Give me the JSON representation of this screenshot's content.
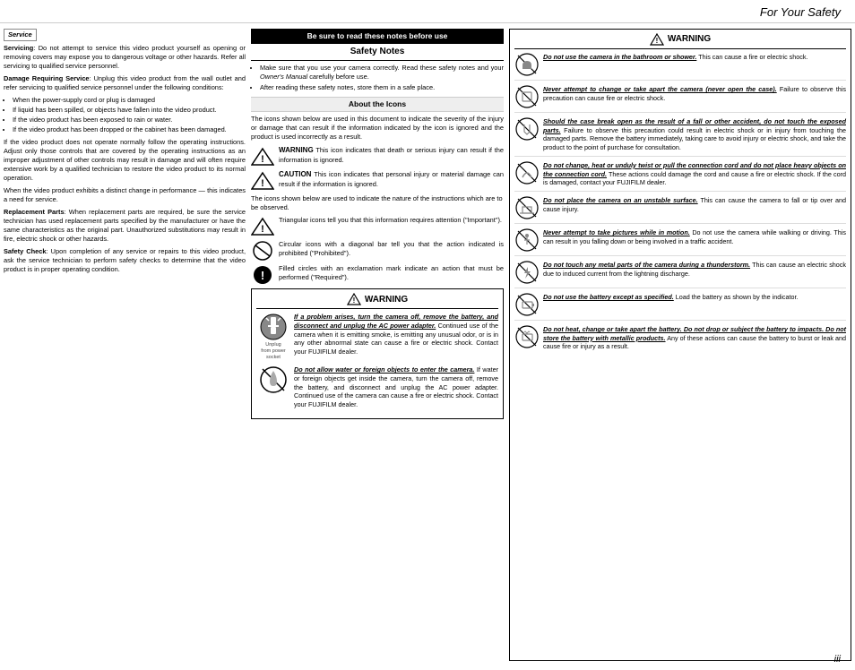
{
  "header": {
    "title": "For Your Safety"
  },
  "footer": {
    "page": "iii"
  },
  "left_column": {
    "service_label": "Service",
    "paragraphs": [
      {
        "label": "Servicing",
        "text": ": Do not attempt to service this video product yourself as opening or removing covers may expose you to dangerous voltage or other hazards.   Refer all servicing to qualified service personnel."
      },
      {
        "label": "Damage Requiring Service",
        "text": ": Unplug this video product from the wall outlet and refer servicing to qualified service personnel under the following conditions:"
      }
    ],
    "damage_bullets": [
      "When the power-supply cord or plug is damaged",
      "If liquid has been spilled, or objects have fallen into the video product.",
      "If the video product has been exposed to rain or water.",
      "If the video product has been dropped or the cabinet has been damaged."
    ],
    "damage_followup": "If the video product does not operate normally follow the operating instructions.  Adjust only those controls that are covered by the operating instructions as an improper adjustment of other controls may result in damage and will often require extensive work by a qualified technician to restore the video product to its normal operation.",
    "performance_text": "When the video product exhibits a distinct change in performance — this indicates a need for service.",
    "replacement_label": "Replacement Parts",
    "replacement_text": ": When replacement parts are required, be sure the service technician has used replacement parts specified by the manufacturer or have the same characteristics as the original part.   Unauthorized substitutions may result in fire, electric shock or other hazards.",
    "safety_check_label": "Safety Check",
    "safety_check_text": ": Upon completion of any service or repairs to this video product, ask the service technician to perform safety checks to determine that the video product is in proper operating condition."
  },
  "middle_column": {
    "read_notes_header": "Be sure to read these notes before use",
    "safety_notes_header": "Safety Notes",
    "safety_bullets": [
      "Make sure that you use your camera correctly.  Read these safety notes and your Owner's Manual carefully before use.",
      "After reading these safety notes, store them in a safe place."
    ],
    "about_icons_header": "About the Icons",
    "about_icons_text": "The icons shown below are used in this document to indicate the severity of the injury or damage that can result if the information indicated by the icon is ignored and the product is used incorrectly as a result.",
    "icon_rows": [
      {
        "badge": "WARNING",
        "text": "This icon indicates that death or serious injury can result if the information is ignored."
      },
      {
        "badge": "CAUTION",
        "text": "This icon indicates that personal injury or material damage can result if the information is ignored."
      }
    ],
    "nature_text": "The icons shown below are used to indicate the nature of the instructions which are to be observed.",
    "nature_rows": [
      {
        "type": "triangle",
        "text": "Triangular icons tell you that this information requires attention (\"Important\")."
      },
      {
        "type": "circle-bar",
        "text": "Circular icons with a diagonal bar tell you that the action indicated is prohibited (\"Prohibited\")."
      },
      {
        "type": "circle-exclaim",
        "text": "Filled circles with an exclamation mark indicate an action that must be performed (\"Required\")."
      }
    ],
    "warning_title": "WARNING",
    "warning_items": [
      {
        "icon_type": "unplug",
        "icon_label": "Unplug from power socket",
        "text_bold": "If a problem arises, turn the camera off, remove the battery, and disconnect and unplug the AC power adapter.",
        "text_normal": "  Continued use of the camera when it is emitting smoke, is emitting any unusual odor, or is in any other abnormal state can cause a fire or electric shock.  Contact your FUJIFILM dealer."
      },
      {
        "icon_type": "no-water",
        "icon_label": "",
        "text_bold": "Do not allow water or foreign objects to enter the camera.",
        "text_normal": "  If water or foreign objects get inside the camera, turn the camera off, remove the battery, and disconnect and unplug the AC power adapter.  Continued use of the camera can cause a fire or electric shock.  Contact your FUJIFILM dealer."
      }
    ]
  },
  "right_column": {
    "warning_title": "WARNING",
    "items": [
      {
        "icon_type": "no-bathroom",
        "text_bold": "Do not use the camera in the bathroom or shower.",
        "text_normal": "  This can cause a fire or electric shock."
      },
      {
        "icon_type": "no-disassemble",
        "text_bold": "Never attempt to change or take apart the camera (never open the case).",
        "text_normal": "  Failure to observe this precaution can cause fire or electric shock."
      },
      {
        "icon_type": "no-touch-internal",
        "text_bold": "Should the case break open as the result of a fall or other accident, do not touch the exposed parts.",
        "text_normal": "  Failure to observe this precaution could result in electric shock or in injury from touching the damaged parts.  Remove the battery immediately, taking care to avoid injury or electric shock, and take the product to the point of purchase for consultation."
      },
      {
        "icon_type": "no-cord-damage",
        "text_bold": "Do not change, heat or unduly twist or pull the connection cord and do not place heavy objects on the connection cord.",
        "text_normal": "  These actions could damage the cord and cause a fire or electric shock.  If the cord is damaged, contact your FUJIFILM dealer."
      },
      {
        "icon_type": "no-unstable",
        "text_bold": "Do not place the camera on an unstable surface.",
        "text_normal": "  This can cause the camera to fall or tip over and cause injury."
      },
      {
        "icon_type": "no-motion",
        "text_bold": "Never attempt to take pictures while in motion.",
        "text_normal": "  Do not use the camera while walking or driving.  This can result in you falling down or being involved in a traffic accident."
      },
      {
        "icon_type": "no-metal-storm",
        "text_bold": "Do not touch any metal parts of the camera during a thunderstorm.",
        "text_normal": "  This can cause an electric shock due to induced current from the lightning discharge."
      },
      {
        "icon_type": "battery-specified",
        "text_bold": "Do not use the battery except as specified.",
        "text_normal": "  Load the battery as shown by the indicator."
      },
      {
        "icon_type": "battery-no-heat",
        "text_bold": "Do not heat, change or take apart the battery.  Do not drop or subject the battery to impacts.  Do not store the battery with metallic products.",
        "text_normal": "  Any of these actions can cause the battery to burst or leak and cause fire or injury as a result."
      }
    ]
  }
}
